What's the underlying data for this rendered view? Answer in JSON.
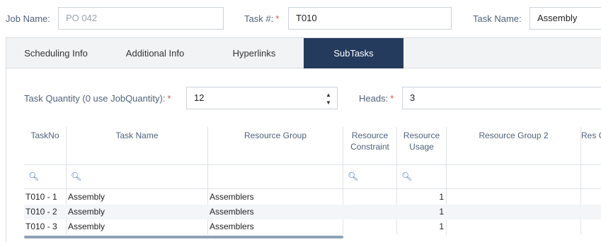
{
  "fields": {
    "job_name": {
      "label": "Job Name:",
      "placeholder": "PO 042"
    },
    "task_no": {
      "label": "Task #:",
      "value": "T010"
    },
    "task_name": {
      "label": "Task Name:",
      "value": "Assembly"
    }
  },
  "tabs": [
    {
      "label": "Scheduling Info",
      "active": false
    },
    {
      "label": "Additional Info",
      "active": false
    },
    {
      "label": "Hyperlinks",
      "active": false
    },
    {
      "label": "SubTasks",
      "active": true
    }
  ],
  "subtasks": {
    "quantity": {
      "label": "Task Quantity (0 use JobQuantity):",
      "value": "12"
    },
    "heads": {
      "label": "Heads:",
      "value": "3"
    },
    "columns": [
      {
        "label": "TaskNo"
      },
      {
        "label": "Task Name"
      },
      {
        "label": "Resource Group"
      },
      {
        "label": "Resource Constraint"
      },
      {
        "label": "Resource Usage"
      },
      {
        "label": "Resource Group 2"
      },
      {
        "label": "Res Cons"
      }
    ],
    "rows": [
      {
        "task_no": "T010 - 1",
        "task_name": "Assembly",
        "resource_group": "Assemblers",
        "usage": "1"
      },
      {
        "task_no": "T010 - 2",
        "task_name": "Assembly",
        "resource_group": "Assemblers",
        "usage": "1"
      },
      {
        "task_no": "T010 - 3",
        "task_name": "Assembly",
        "resource_group": "Assemblers",
        "usage": "1"
      }
    ]
  }
}
